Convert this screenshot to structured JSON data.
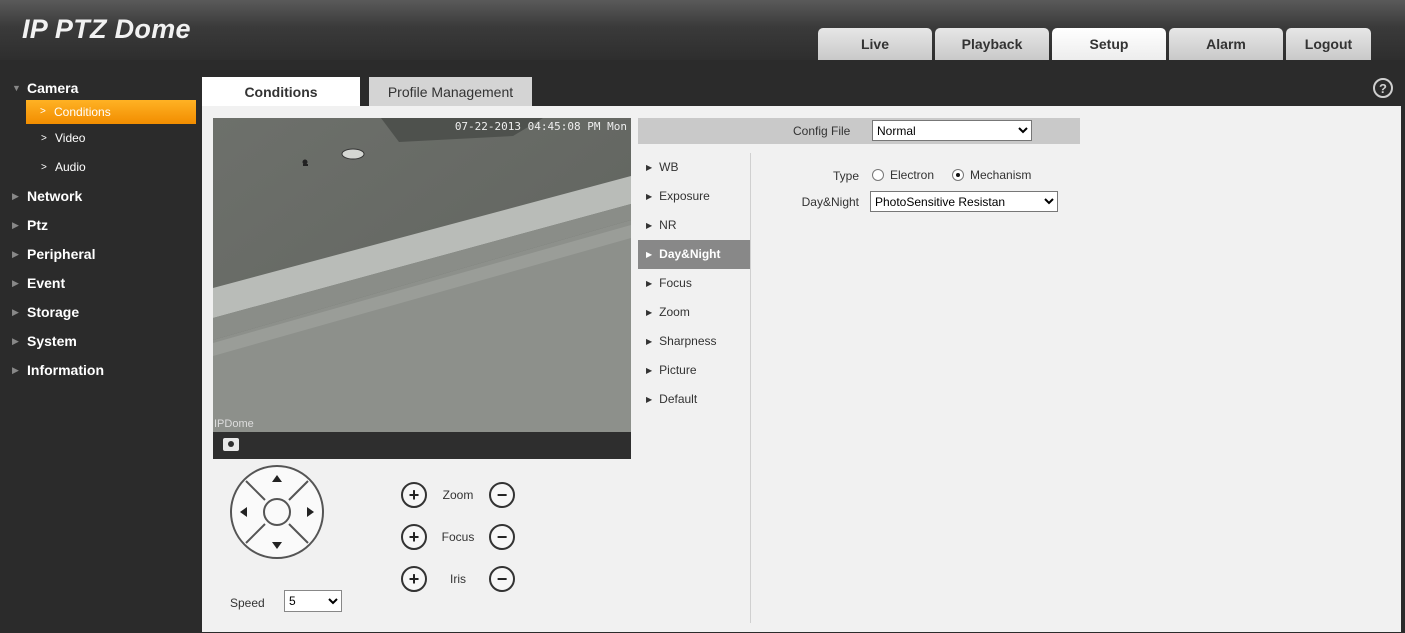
{
  "app": {
    "title": "IP PTZ Dome"
  },
  "top_nav": [
    {
      "label": "Live",
      "active": false
    },
    {
      "label": "Playback",
      "active": false
    },
    {
      "label": "Setup",
      "active": true
    },
    {
      "label": "Alarm",
      "active": false
    },
    {
      "label": "Logout",
      "active": false
    }
  ],
  "sidebar": {
    "camera": "Camera",
    "camera_items": [
      "Conditions",
      "Video",
      "Audio"
    ],
    "groups": [
      "Network",
      "Ptz",
      "Peripheral",
      "Event",
      "Storage",
      "System",
      "Information"
    ]
  },
  "tabs": {
    "conditions": "Conditions",
    "profile": "Profile Management"
  },
  "help": "?",
  "video": {
    "timestamp": "07-22-2013 04:45:08 PM Mon",
    "osd_name": "IPDome"
  },
  "ptz": {
    "speed_label": "Speed",
    "speed_value": "5",
    "plus": "+",
    "minus": "−",
    "zoom": "Zoom",
    "focus": "Focus",
    "iris": "Iris"
  },
  "config": {
    "label": "Config File",
    "value": "Normal"
  },
  "side_menu": [
    "WB",
    "Exposure",
    "NR",
    "Day&Night",
    "Focus",
    "Zoom",
    "Sharpness",
    "Picture",
    "Default"
  ],
  "side_menu_active": "Day&Night",
  "form": {
    "type_label": "Type",
    "type_options": [
      "Electron",
      "Mechanism"
    ],
    "type_selected": "Mechanism",
    "daynight_label": "Day&Night",
    "daynight_value": "PhotoSensitive Resistan"
  },
  "colors": {
    "accent": "#f39a0e",
    "active_menu": "#888888"
  }
}
